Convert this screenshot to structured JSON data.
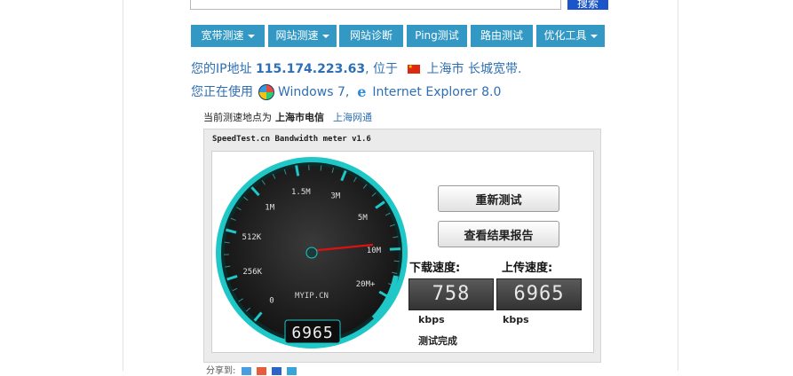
{
  "search": {
    "button_label": "搜索"
  },
  "nav": [
    {
      "label": "宽带测速",
      "dropdown": true
    },
    {
      "label": "网站测速",
      "dropdown": true
    },
    {
      "label": "网站诊断",
      "dropdown": false
    },
    {
      "label": "Ping测试",
      "dropdown": false
    },
    {
      "label": "路由测试",
      "dropdown": false
    },
    {
      "label": "优化工具",
      "dropdown": true
    }
  ],
  "ip_info": {
    "prefix": "您的IP地址",
    "ip": "115.174.223.63",
    "located_at": ", 位于",
    "location": "上海市 长城宽带."
  },
  "os_info": {
    "prefix": "您正在使用",
    "os": "Windows 7,",
    "browser": "Internet Explorer 8.0"
  },
  "test_node": {
    "prefix": "当前测速地点为",
    "node": "上海市电信",
    "alt_link": "上海网通"
  },
  "meter": {
    "title": "SpeedTest.cn Bandwidth meter v1.6",
    "brand": "MYIP.CN",
    "scale_labels": [
      "0",
      "256K",
      "512K",
      "1M",
      "1.5M",
      "3M",
      "5M",
      "10M",
      "20M+"
    ],
    "readout": "6965",
    "retest_label": "重新测试",
    "report_label": "查看结果报告",
    "download": {
      "label": "下载速度:",
      "value": "758",
      "unit": "kbps"
    },
    "upload": {
      "label": "上传速度:",
      "value": "6965",
      "unit": "kbps"
    },
    "status": "测试完成",
    "colors": {
      "accent": "#1fc7c7",
      "needle": "#dd1111",
      "dial": "#1a1a1a"
    }
  },
  "share": {
    "label": "分享到:"
  }
}
